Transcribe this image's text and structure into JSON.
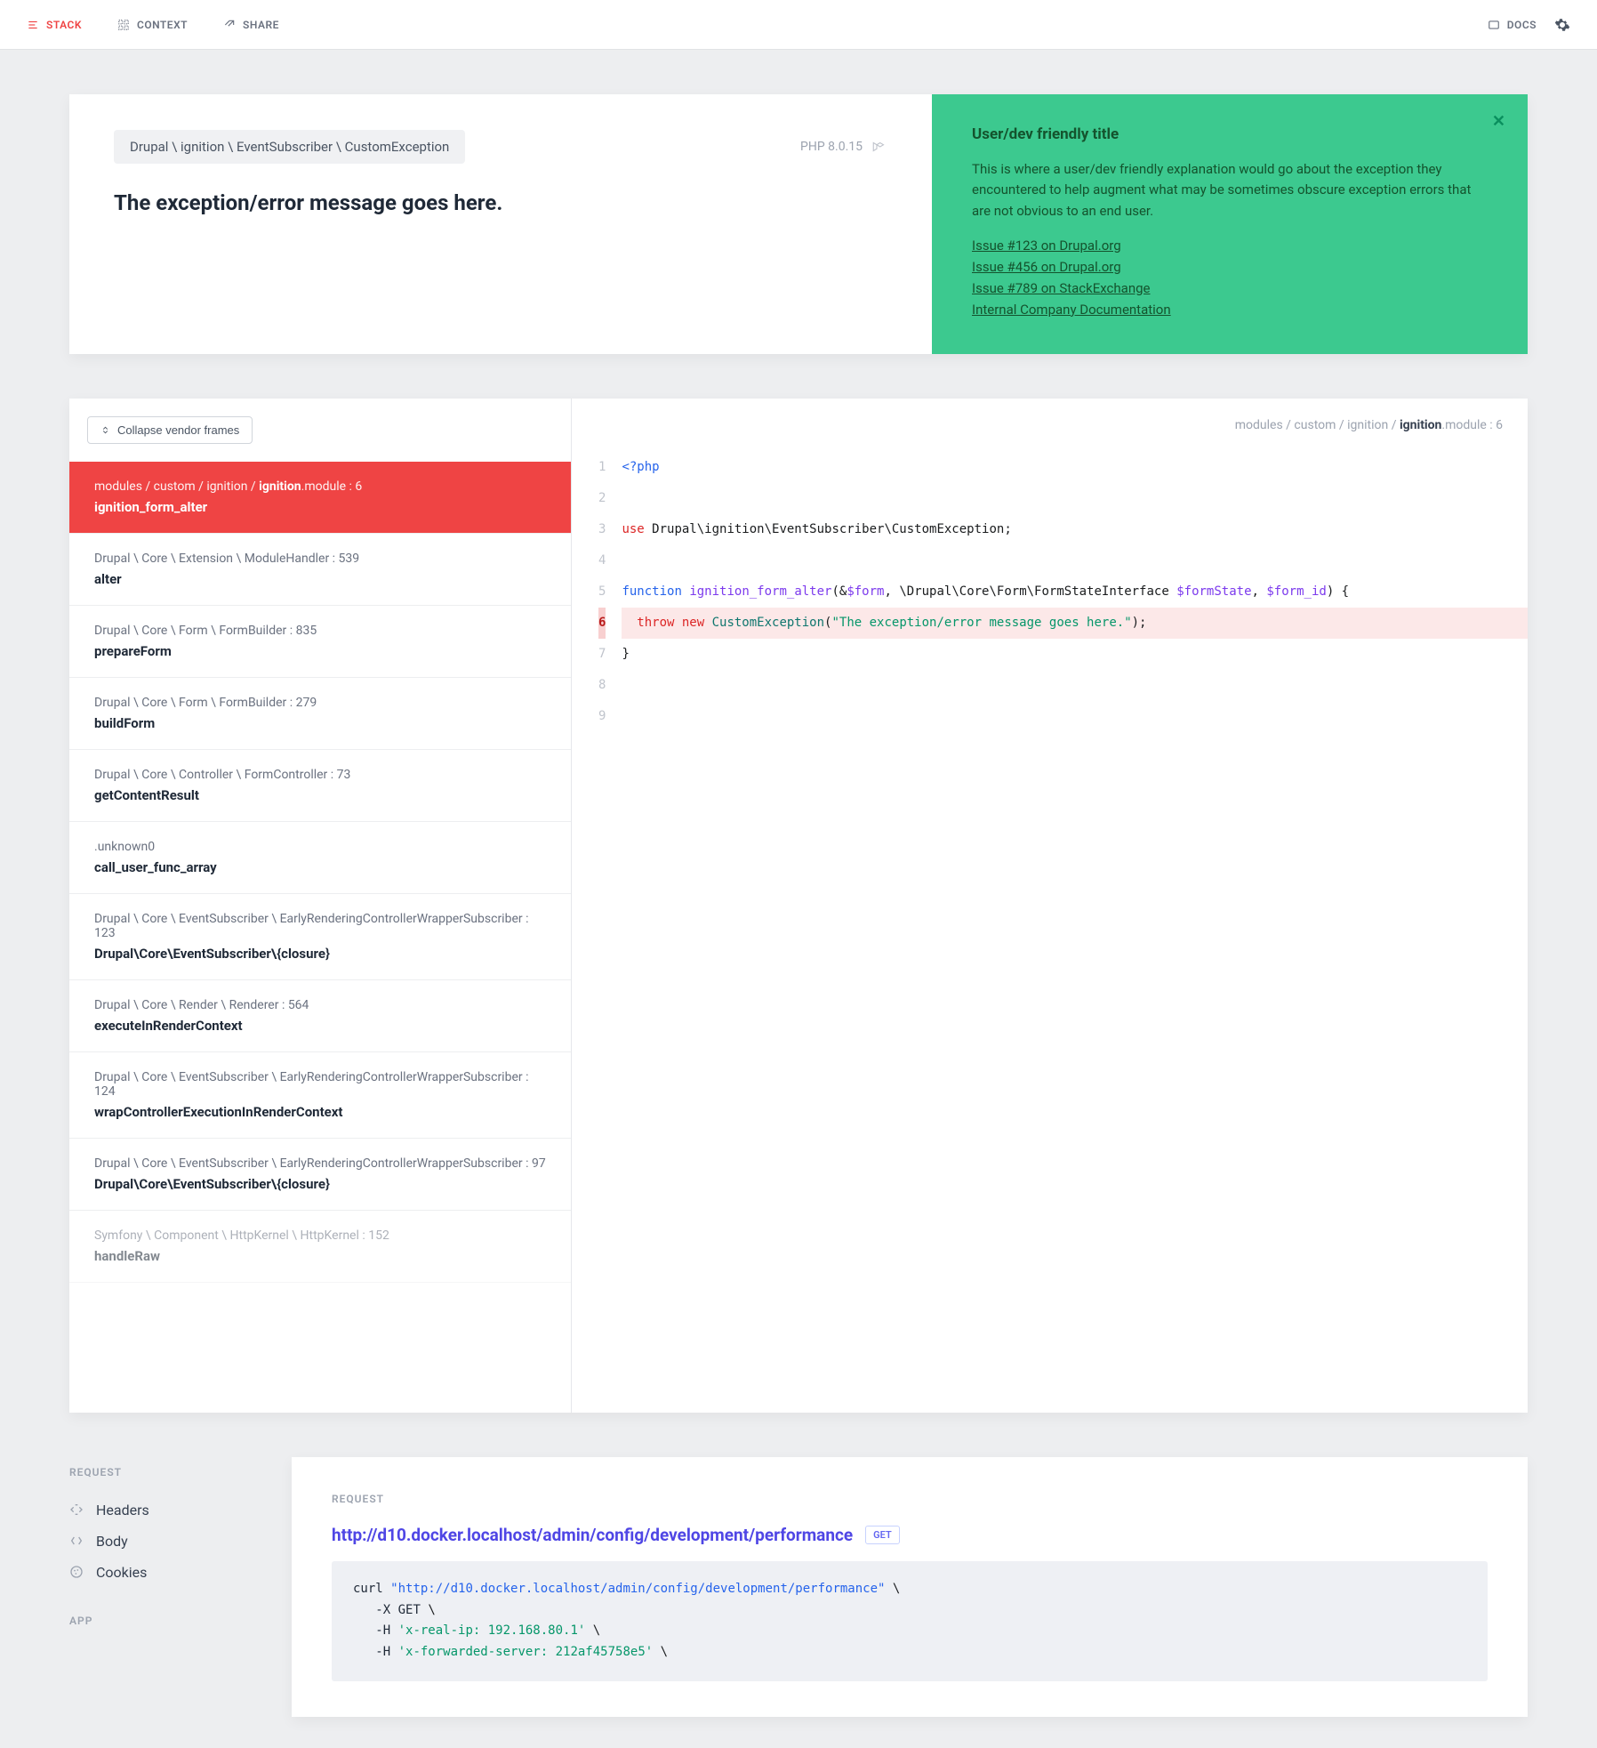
{
  "topbar": {
    "stack": "STACK",
    "context": "CONTEXT",
    "share": "SHARE",
    "docs": "DOCS"
  },
  "hero": {
    "breadcrumb": "Drupal \\ ignition \\ EventSubscriber \\ CustomException",
    "php_version": "PHP 8.0.15",
    "title": "The exception/error message goes here.",
    "solution": {
      "title": "User/dev friendly title",
      "body": "This is where a user/dev friendly explanation would go about the exception they encountered to help augment what may be sometimes obscure exception errors that are not obvious to an end user.",
      "links": [
        "Issue #123 on Drupal.org",
        "Issue #456 on Drupal.org",
        "Issue #789 on StackExchange",
        "Internal Company Documentation"
      ]
    }
  },
  "frames": {
    "collapse_label": "Collapse vendor frames",
    "items": [
      {
        "path_pre": "modules / custom / ignition / ",
        "path_strong": "ignition",
        "path_post": ".module : 6",
        "fn": "ignition_form_alter",
        "active": true
      },
      {
        "path_pre": "Drupal \\ Core \\ Extension \\ ModuleHandler : 539",
        "path_strong": "",
        "path_post": "",
        "fn": "alter"
      },
      {
        "path_pre": "Drupal \\ Core \\ Form \\ FormBuilder : 835",
        "path_strong": "",
        "path_post": "",
        "fn": "prepareForm"
      },
      {
        "path_pre": "Drupal \\ Core \\ Form \\ FormBuilder : 279",
        "path_strong": "",
        "path_post": "",
        "fn": "buildForm"
      },
      {
        "path_pre": "Drupal \\ Core \\ Controller \\ FormController : 73",
        "path_strong": "",
        "path_post": "",
        "fn": "getContentResult"
      },
      {
        "path_pre": ".unknown0",
        "path_strong": "",
        "path_post": "",
        "fn": "call_user_func_array"
      },
      {
        "path_pre": "Drupal \\ Core \\ EventSubscriber \\ EarlyRenderingControllerWrapperSubscriber : 123",
        "path_strong": "",
        "path_post": "",
        "fn": "Drupal\\Core\\EventSubscriber\\{closure}"
      },
      {
        "path_pre": "Drupal \\ Core \\ Render \\ Renderer : 564",
        "path_strong": "",
        "path_post": "",
        "fn": "executeInRenderContext"
      },
      {
        "path_pre": "Drupal \\ Core \\ EventSubscriber \\ EarlyRenderingControllerWrapperSubscriber : 124",
        "path_strong": "",
        "path_post": "",
        "fn": "wrapControllerExecutionInRenderContext"
      },
      {
        "path_pre": "Drupal \\ Core \\ EventSubscriber \\ EarlyRenderingControllerWrapperSubscriber : 97",
        "path_strong": "",
        "path_post": "",
        "fn": "Drupal\\Core\\EventSubscriber\\{closure}"
      },
      {
        "path_pre": "Symfony \\ Component \\ HttpKernel \\ HttpKernel : 152",
        "path_strong": "",
        "path_post": "",
        "fn": "handleRaw",
        "faded": true
      }
    ]
  },
  "code": {
    "header_pre": "modules / custom / ignition / ",
    "header_strong": "ignition",
    "header_post": ".module : 6",
    "lines": [
      {
        "n": 1,
        "html": "<span class='tok-php'>&lt;?php</span>"
      },
      {
        "n": 2,
        "html": ""
      },
      {
        "n": 3,
        "html": "<span class='tok-use'>use</span> Drupal\\ignition\\EventSubscriber\\CustomException;"
      },
      {
        "n": 4,
        "html": ""
      },
      {
        "n": 5,
        "html": "<span class='tok-kw'>function</span> <span class='tok-fn'>ignition_form_alter</span>(&amp;<span class='tok-var'>$form</span>, \\Drupal\\Core\\Form\\FormStateInterface <span class='tok-var'>$formState</span>, <span class='tok-var'>$form_id</span>) {"
      },
      {
        "n": 6,
        "html": "  <span class='tok-throw'>throw new</span> <span class='tok-cls'>CustomException</span>(<span class='tok-str'>\"The exception/error message goes here.\"</span>);",
        "hl": true
      },
      {
        "n": 7,
        "html": "}"
      },
      {
        "n": 8,
        "html": ""
      },
      {
        "n": 9,
        "html": ""
      }
    ]
  },
  "context": {
    "nav": {
      "request_h": "REQUEST",
      "headers": "Headers",
      "body": "Body",
      "cookies": "Cookies",
      "app_h": "APP"
    },
    "body": {
      "section": "REQUEST",
      "url": "http://d10.docker.localhost/admin/config/development/performance",
      "method": "GET",
      "curl_lines": [
        {
          "html": "<span class='c-cmd'>curl</span> <span class='c-str'>\"http://d10.docker.localhost/admin/config/development/performance\"</span> \\"
        },
        {
          "html": "   <span class='c-flag'>-X</span> <span class='c-cmd'>GET</span> \\"
        },
        {
          "html": "   <span class='c-flag'>-H</span> <span class='c-hdr'>'x-real-ip: 192.168.80.1'</span> \\"
        },
        {
          "html": "   <span class='c-flag'>-H</span> <span class='c-hdr'>'x-forwarded-server: 212af45758e5'</span> \\"
        }
      ]
    }
  }
}
